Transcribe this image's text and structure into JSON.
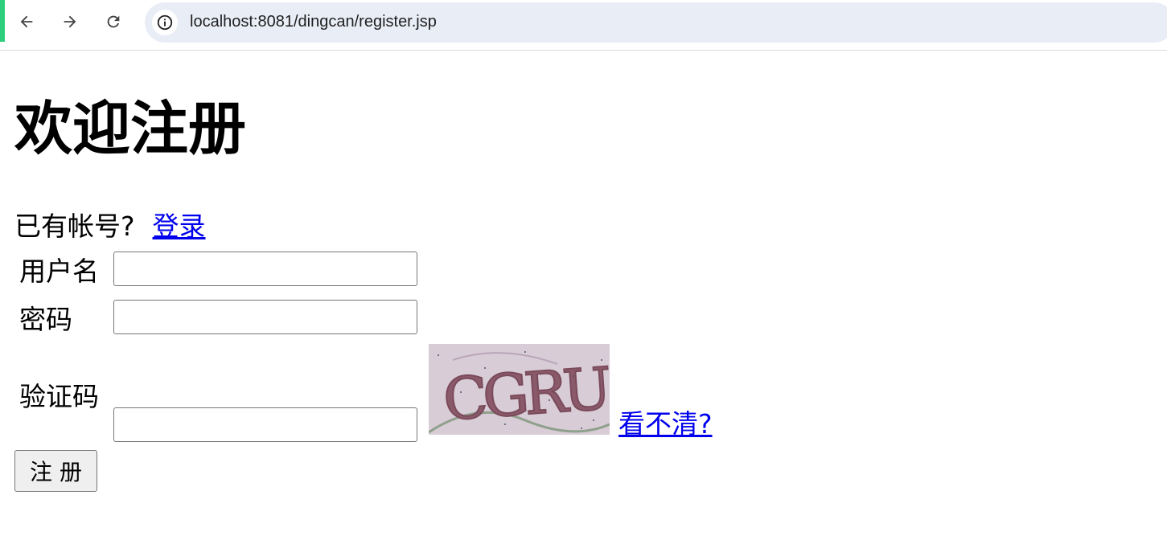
{
  "browser": {
    "url": "localhost:8081/dingcan/register.jsp",
    "accent_color": "#2ecf7b"
  },
  "page": {
    "title": "欢迎注册",
    "have_account_text": "已有帐号?",
    "login_link": "登录",
    "form": {
      "username_label": "用户名",
      "username_value": "",
      "password_label": "密码",
      "password_value": "",
      "captcha_label": "验证码",
      "captcha_value": "",
      "captcha_image_text": "CGRU",
      "refresh_link": "看不清? ",
      "submit_label": "注 册"
    },
    "link_color": "#0000ee"
  }
}
